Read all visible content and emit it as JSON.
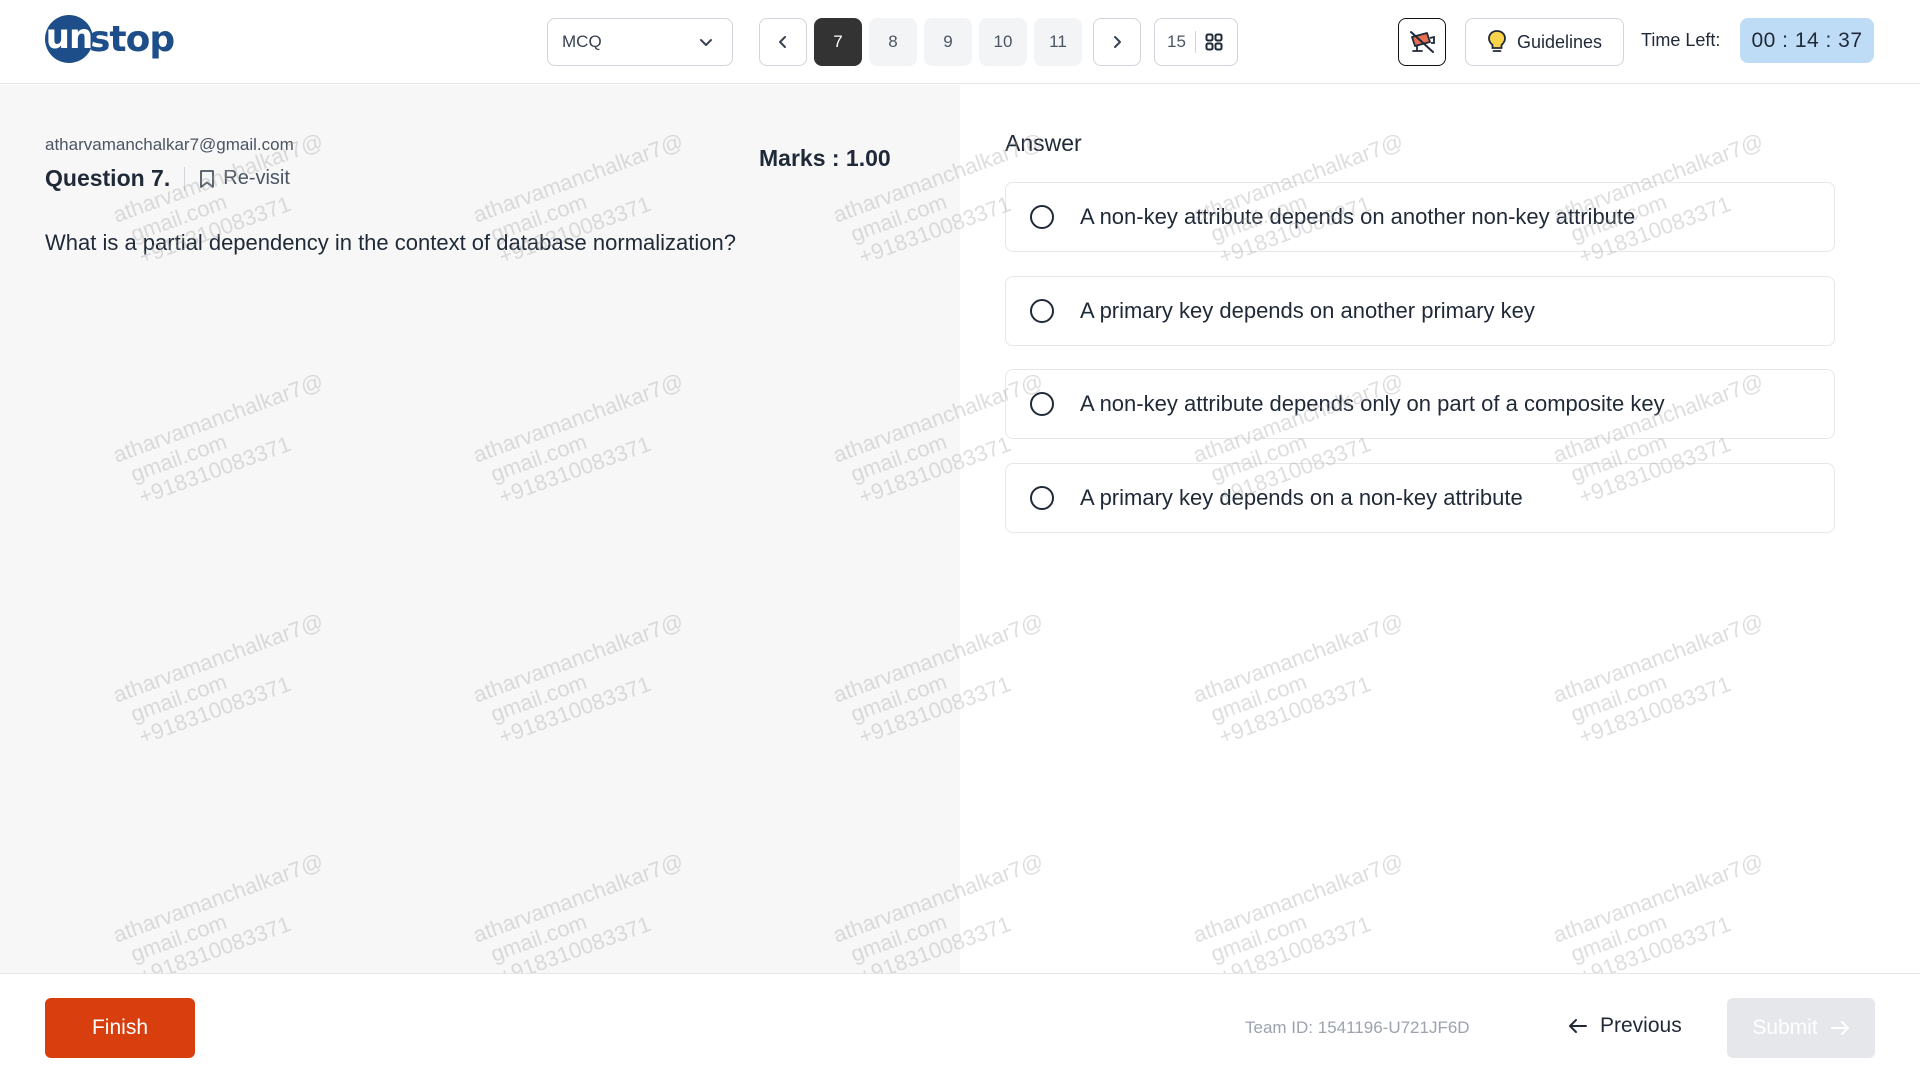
{
  "header": {
    "logo": {
      "first": "un",
      "rest": "stop"
    },
    "section_select": "MCQ",
    "question_nav": [
      "7",
      "8",
      "9",
      "10",
      "11"
    ],
    "active_question": "7",
    "total_questions": "15",
    "guidelines_label": "Guidelines",
    "time_left_label": "Time Left:",
    "timer": "00 : 14 : 37"
  },
  "question": {
    "candidate_email": "atharvamanchalkar7@gmail.com",
    "title": "Question 7.",
    "revisit_label": "Re-visit",
    "marks": "Marks : 1.00",
    "text": "What is a partial dependency in the context of database normalization?"
  },
  "answer": {
    "label": "Answer",
    "options": [
      "A non-key attribute depends on another non-key attribute",
      "A primary key depends on another primary key",
      "A non-key attribute depends only on part of a composite key",
      "A primary key depends on a non-key attribute"
    ]
  },
  "watermark": {
    "line1": "atharvamanchalkar7@",
    "line2": "gmail.com",
    "line3": "+918310083371"
  },
  "footer": {
    "finish_label": "Finish",
    "team_id": "Team ID: 1541196-U721JF6D",
    "previous_label": "Previous",
    "submit_label": "Submit"
  },
  "colors": {
    "brand": "#1d4e89",
    "finish": "#d93e0e",
    "timer_bg": "#bfdcf7",
    "active_nav": "#333333"
  }
}
